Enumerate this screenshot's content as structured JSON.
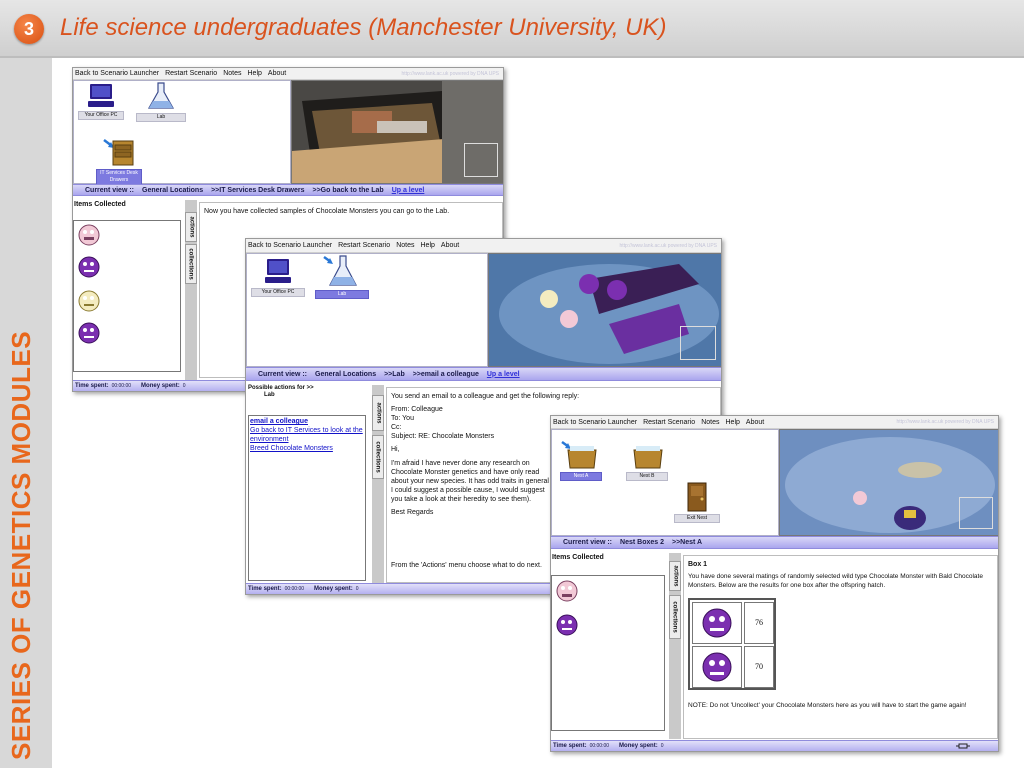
{
  "slide": {
    "number": "3",
    "title": "Life science undergraduates (Manchester  University, UK)",
    "side_label": "SERIES OF GENETICS MODULES"
  },
  "menu": {
    "back": "Back to Scenario Launcher",
    "restart": "Restart Scenario",
    "notes": "Notes",
    "help": "Help",
    "about": "About",
    "url_hint": "http://www.lank.ac.uk   powered by DNA UPS"
  },
  "labels": {
    "items_collected": "Items Collected",
    "actions_tab": "actions",
    "collections_tab": "collections",
    "current_view": "Current view ::",
    "up_level": "Up a level",
    "time_spent": "Time spent:",
    "time_value": "00:00:00",
    "money_spent": "Money spent:",
    "money_value": "0"
  },
  "window1": {
    "loc_office": "Your Office PC",
    "loc_lab": "Lab",
    "loc_drawers": "IT Services Desk Drawers",
    "crumb1": "General Locations",
    "crumb2": ">>IT Services Desk Drawers",
    "crumb3": ">>Go back to the Lab",
    "message": "Now you have collected samples of Chocolate Monsters you can go to the Lab."
  },
  "window2": {
    "loc_office": "Your Office PC",
    "loc_lab": "Lab",
    "crumb1": "General Locations",
    "crumb2": ">>Lab",
    "crumb3": ">>email a colleague",
    "possible_actions": "Possible actions for >>",
    "possible_actions_loc": "Lab",
    "actions": [
      "email a colleague",
      "Go back to IT Services to look at the environment",
      "Breed Chocolate Monsters"
    ],
    "email_intro": "You send an email to a colleague and get the following reply:",
    "email_from": "From: Colleague",
    "email_to": "To: You",
    "email_cc": "Cc:",
    "email_subject": "Subject: RE: Chocolate Monsters",
    "email_greeting": "Hi,",
    "email_body": "I'm afraid I have never done any research on Chocolate Monster genetics and have only read about your new species. It has odd traits in general I could suggest a possible cause, I would suggest you take a look at their heredity to see them).",
    "email_sign": "Best Regards",
    "footer_hint": "From the 'Actions' menu choose what to do next."
  },
  "window3": {
    "loc_nest_a": "Nest A",
    "loc_nest_b": "Nest B",
    "loc_exit": "Exit Nest",
    "crumb1": "Nest Boxes 2",
    "crumb2": ">>Nest A",
    "box_title": "Box 1",
    "box_text": "You have done several matings of randomly selected wild type Chocolate Monster with Bald Chocolate Monsters. Below are the results for one box after the offspring hatch.",
    "result1": "76",
    "result2": "70",
    "note": "NOTE: Do not 'Uncollect' your Chocolate Monsters here as you will have to start the game again!"
  },
  "colors": {
    "accent_orange": "#e8671c",
    "nav_purple": "#aaa6ee",
    "monster_purple": "#7b2fb0",
    "monster_cream": "#f4ecc0"
  }
}
